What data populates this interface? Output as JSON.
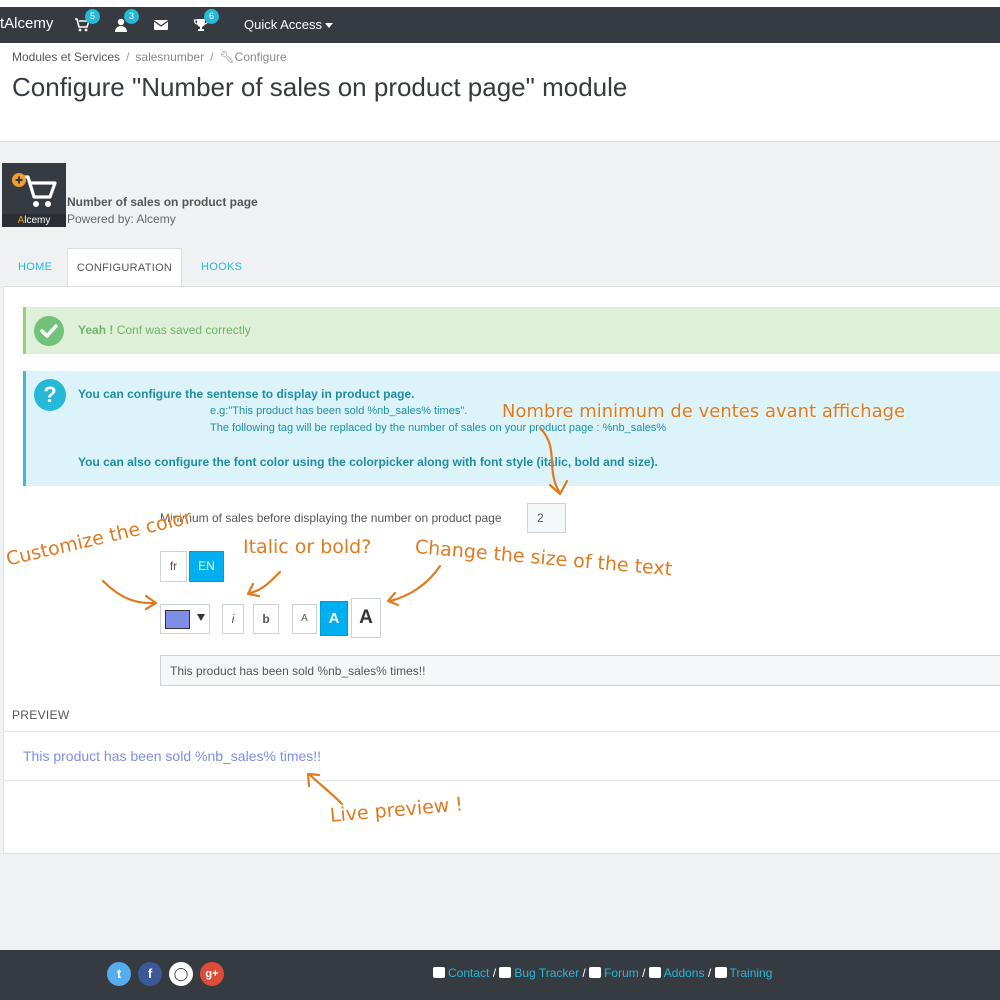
{
  "topbar": {
    "brand": "tAlcemy",
    "badges": {
      "orders": "5",
      "customers": "3",
      "achievements": "6"
    },
    "quick_access": "Quick Access"
  },
  "breadcrumb": {
    "items": [
      "Modules et Services",
      "salesnumber",
      "Configure"
    ]
  },
  "page": {
    "title": "Configure \"Number of sales on product page\" module"
  },
  "module": {
    "logo_caption_highlight": "A",
    "logo_caption_rest": "lcemy",
    "name": "Number of sales on product page",
    "powered_by": "Powered by: Alcemy"
  },
  "tabs": [
    "HOME",
    "CONFIGURATION",
    "HOOKS"
  ],
  "alerts": {
    "success_bold": "Yeah !",
    "success_text": " Conf was saved correctly",
    "info_line1": "You can configure the sentense to display in product page.",
    "info_line2": "e.g:\"This product has been sold %nb_sales% times\".",
    "info_line3": "The following tag will be replaced by the number of sales on your product page : %nb_sales%",
    "info_line4": "You can also configure the font color using the colorpicker along with font style (italic, bold and size)."
  },
  "form": {
    "min_sales_label": "Minimum of sales before displaying the number on product page",
    "min_sales_value": "2",
    "lang_fr": "fr",
    "lang_en": "EN",
    "italic": "i",
    "bold": "b",
    "size_small": "A",
    "size_medium": "A",
    "size_large": "A",
    "color": "#7e8ee6",
    "sentence_value": "This product has been sold %nb_sales% times!!"
  },
  "preview": {
    "heading": "PREVIEW",
    "text": "This product has been sold %nb_sales% times!!"
  },
  "annotations": {
    "min_sales": "Nombre minimum de ventes avant affichage",
    "color": "Customize the color",
    "style": "Italic or bold?",
    "size": "Change the size of the text",
    "preview": "Live preview !"
  },
  "footer": {
    "social": [
      "twitter",
      "facebook",
      "github",
      "google-plus"
    ],
    "links": [
      "Contact",
      "Bug Tracker",
      "Forum",
      "Addons",
      "Training"
    ]
  },
  "colors": {
    "topbar": "#363a41",
    "accent": "#25b9d7",
    "annotation": "#e07a1f",
    "success_bg": "#dff0d8",
    "info_bg": "#dcf4f9"
  }
}
